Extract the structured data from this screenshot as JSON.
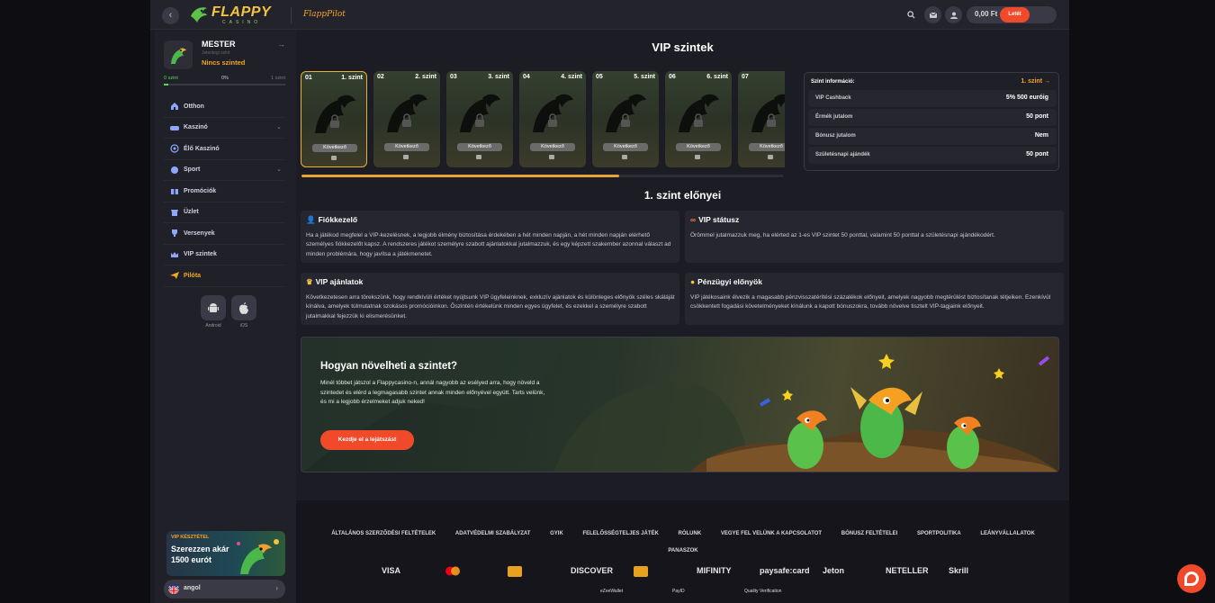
{
  "header": {
    "logo_text": "FLAPPY",
    "logo_sub": "CASINO",
    "pilot_logo": "FlappPilot",
    "balance": "0,00 Ft",
    "deposit_label": "Letét"
  },
  "sidebar": {
    "user_name": "MESTER",
    "level_caption": "Jelenlegi szint",
    "level_value": "Nincs szinted",
    "progress_start": "0 szint",
    "progress_percent": "0%",
    "progress_end": "1 szint",
    "progress_fraction": 0,
    "items": [
      {
        "label": "Otthon",
        "icon": "home-icon"
      },
      {
        "label": "Kaszinó",
        "icon": "gamepad-icon",
        "has_chevron": true
      },
      {
        "label": "Élő Kaszinó",
        "icon": "live-icon"
      },
      {
        "label": "Sport",
        "icon": "ball-icon",
        "has_chevron": true
      },
      {
        "label": "Promóciók",
        "icon": "gift-icon"
      },
      {
        "label": "Üzlet",
        "icon": "shop-icon"
      },
      {
        "label": "Versenyek",
        "icon": "trophy-icon"
      },
      {
        "label": "VIP szintek",
        "icon": "crown-icon"
      },
      {
        "label": "Pilóta",
        "icon": "plane-icon",
        "highlight": true
      }
    ],
    "apps": [
      {
        "label": "Android",
        "icon": "android-icon"
      },
      {
        "label": "iOS",
        "icon": "apple-icon"
      }
    ],
    "promo_tag": "VIP KÉSZTÉTEL",
    "promo_text": "Szerezzen akár 1500 eurót",
    "language": "angol"
  },
  "main": {
    "title": "VIP szintek",
    "levels": [
      {
        "num": "01",
        "label": "1. szint",
        "next": "Következő",
        "active": true
      },
      {
        "num": "02",
        "label": "2. szint",
        "next": "Következő"
      },
      {
        "num": "03",
        "label": "3. szint",
        "next": "Következő"
      },
      {
        "num": "04",
        "label": "4. szint",
        "next": "Következő"
      },
      {
        "num": "05",
        "label": "5. szint",
        "next": "Következő"
      },
      {
        "num": "06",
        "label": "6. szint",
        "next": "Következő"
      },
      {
        "num": "07",
        "label": "7",
        "next": "Következő"
      }
    ],
    "info": {
      "header": "Szint információ:",
      "level": "1. szint",
      "rows": [
        {
          "key": "VIP Cashback",
          "value": "5% 500 euróig"
        },
        {
          "key": "Érmék jutalom",
          "value": "50 pont"
        },
        {
          "key": "Bónusz jutalom",
          "value": "Nem"
        },
        {
          "key": "Születésnapi ajándék",
          "value": "50 pont"
        }
      ]
    },
    "benefits_title": "1. szint előnyei",
    "benefits": [
      {
        "icon": "person-icon",
        "title": "Fiókkezelő",
        "text": "Ha a játékod megfelel a VIP-kezelésnek, a legjobb élmény biztosítása érdekében a hét minden napján, a hét minden napján elérhető személyes fiókkezelőt kapsz. A rendszeres játékot személyre szabott ajánlatokkal jutalmazzuk, és egy képzett szakember azonnal választ ad minden problémára, hogy javítsa a játékmenetet."
      },
      {
        "icon": "infinity-icon",
        "title": "VIP státusz",
        "text": "Örömmel jutalmazzuk meg, ha elérted az 1-es VIP szintet 50 ponttal, valamint 50 ponttal a születésnapi ajándékodért."
      },
      {
        "icon": "crown-icon",
        "title": "VIP ajánlatok",
        "text": "Következetesen arra törekszünk, hogy rendkívüli értéket nyújtsunk VIP ügyfeleinknek, exkluzív ajánlatok és különleges előnyök széles skáláját kínálva, amelyek túlmutatnak szokásos promócióinkon. Őszintén értékelünk minden egyes ügyfelet, és ezekkel a személyre szabott jutalmakkal fejezzük ki elismerésünket."
      },
      {
        "icon": "coin-icon",
        "title": "Pénzügyi előnyök",
        "text": "VIP játékosaink élvezik a magasabb pénzvisszatérítési százalékok előnyeit, amelyek nagyobb megtérülést biztosítanak tétjeiken. Ezenkívül csökkentett fogadási követelményeket kínálunk a kapott bónuszokra, tovább növelve tisztelt VIP-tagjaink előnyeit."
      }
    ],
    "banner": {
      "title": "Hogyan növelheti a szintet?",
      "text": "Minél többet játszol a Flappycasino-n, annál nagyobb az esélyed arra, hogy növeld a szintedet és elérd a legmagasabb szintet annak minden előnyével együtt. Tarts velünk, és mi a legjobb érzelmeket adjuk neked!",
      "button": "Kezdje el a lejátszást"
    }
  },
  "footer": {
    "links": [
      "ÁLTALÁNOS SZERZŐDÉSI FELTÉTELEK",
      "ADATVÉDELMI SZABÁLYZAT",
      "GYIK",
      "FELELŐSSÉGTELJES JÁTÉK",
      "RÓLUNK",
      "VEGYE FEL VELÜNK A KAPCSOLATOT",
      "BÓNUSZ FELTÉTELEI",
      "SPORTPOLITIKA",
      "LEÁNYVÁLLALATOK",
      "PANASZOK"
    ],
    "payments": [
      "VISA",
      "mastercard",
      "",
      "DISCOVER",
      "",
      "MIFINITY",
      "paysafe:card",
      "Jeton",
      "NETELLER",
      "Skrill"
    ],
    "payments2": [
      "eZeeWallet",
      "PayID",
      "Quality Verification"
    ]
  },
  "colors": {
    "accent": "#f04a2a",
    "gold": "#f5a623",
    "nav_icon": "#8fa6ff"
  }
}
